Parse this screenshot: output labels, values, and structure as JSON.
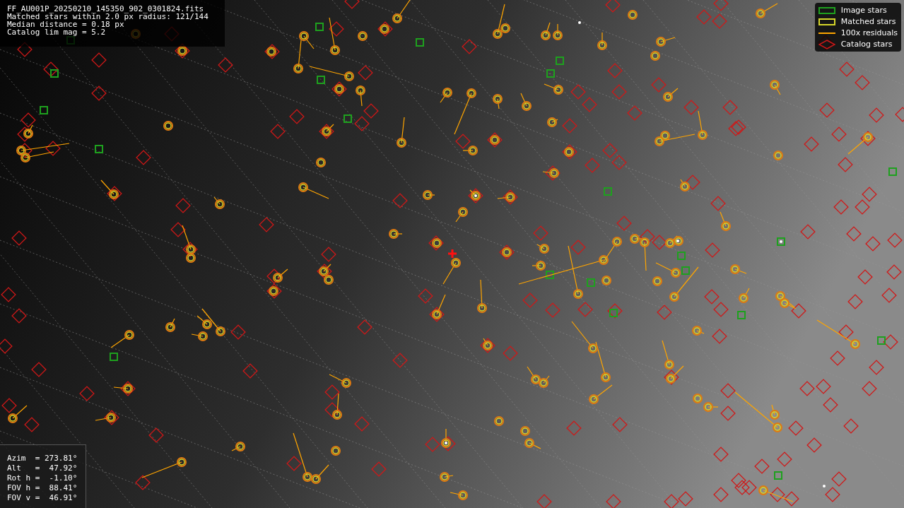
{
  "info_box": {
    "lines": [
      "FF_AU001P_20250210_145350_902_0301824.fits",
      "Matched stars within 2.0 px radius: 121/144",
      "Median distance = 0.18 px",
      "Catalog lim mag = 5.2"
    ]
  },
  "legend": {
    "items": [
      {
        "kind": "image",
        "label": "Image stars",
        "color": "#1ea01e"
      },
      {
        "kind": "matched",
        "label": "Matched stars",
        "color": "#d6d62a"
      },
      {
        "kind": "residual",
        "label": "100x residuals",
        "color": "#ffa500"
      },
      {
        "kind": "catalog",
        "label": "Catalog stars",
        "color": "#d01818"
      }
    ]
  },
  "pointing_box": {
    "lines": [
      "Azim  = 273.81°",
      "Alt   =  47.92°",
      "Rot h =  -1.10°",
      "FOV h =  88.41°",
      "FOV v =  46.91°"
    ]
  }
}
